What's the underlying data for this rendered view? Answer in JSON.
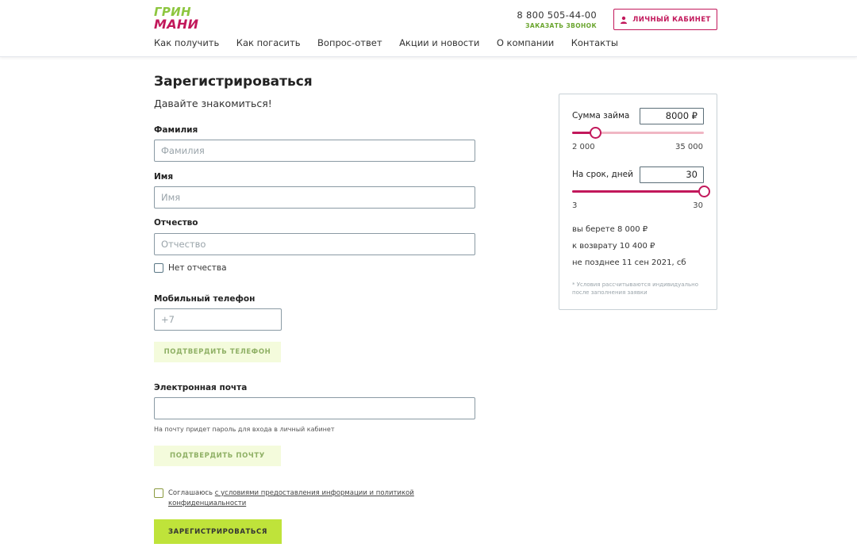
{
  "header": {
    "logo_line1": "ГРИН",
    "logo_line2": "МАНИ",
    "nav": [
      "Как получить",
      "Как погасить",
      "Вопрос-ответ",
      "Акции и новости",
      "О компании",
      "Контакты"
    ],
    "phone": "8 800 505-44-00",
    "callback": "ЗАКАЗАТЬ ЗВОНОК",
    "cabinet": "ЛИЧНЫЙ КАБИНЕТ"
  },
  "form": {
    "title": "Зарегистрироваться",
    "subtitle": "Давайте знакомиться!",
    "lastname_label": "Фамилия",
    "lastname_placeholder": "Фамилия",
    "firstname_label": "Имя",
    "firstname_placeholder": "Имя",
    "middlename_label": "Отчество",
    "middlename_placeholder": "Отчество",
    "no_middlename": "Нет отчества",
    "phone_label": "Мобильный телефон",
    "phone_placeholder": "+7",
    "confirm_phone": "ПОДТВЕРДИТЬ ТЕЛЕФОН",
    "email_label": "Электронная почта",
    "email_hint": "На почту придет пароль для входа в личный кабинет",
    "confirm_email": "ПОДТВЕРДИТЬ ПОЧТУ",
    "agree_prefix": "Соглашаюсь ",
    "agree_link": "с условиями предоставления информации и политикой конфиденциальности",
    "submit": "ЗАРЕГИСТРИРОВАТЬСЯ"
  },
  "calculator": {
    "amount_label": "Сумма займа",
    "amount_value": "8000 ₽",
    "amount_min": "2 000",
    "amount_max": "35 000",
    "amount_fraction": 0.18,
    "term_label": "На срок, дней",
    "term_value": "30",
    "term_min": "3",
    "term_max": "30",
    "term_fraction": 1.0,
    "take": "вы берете  8 000 ₽",
    "return": "к возврату  10 400 ₽",
    "deadline": "не позднее  11 сен 2021, сб",
    "note": "* Условия рассчитываются индивидуально после заполнения заявки"
  },
  "colors": {
    "accent": "#c2185b",
    "green": "#8dc63f",
    "button_green": "#bfe33a"
  }
}
